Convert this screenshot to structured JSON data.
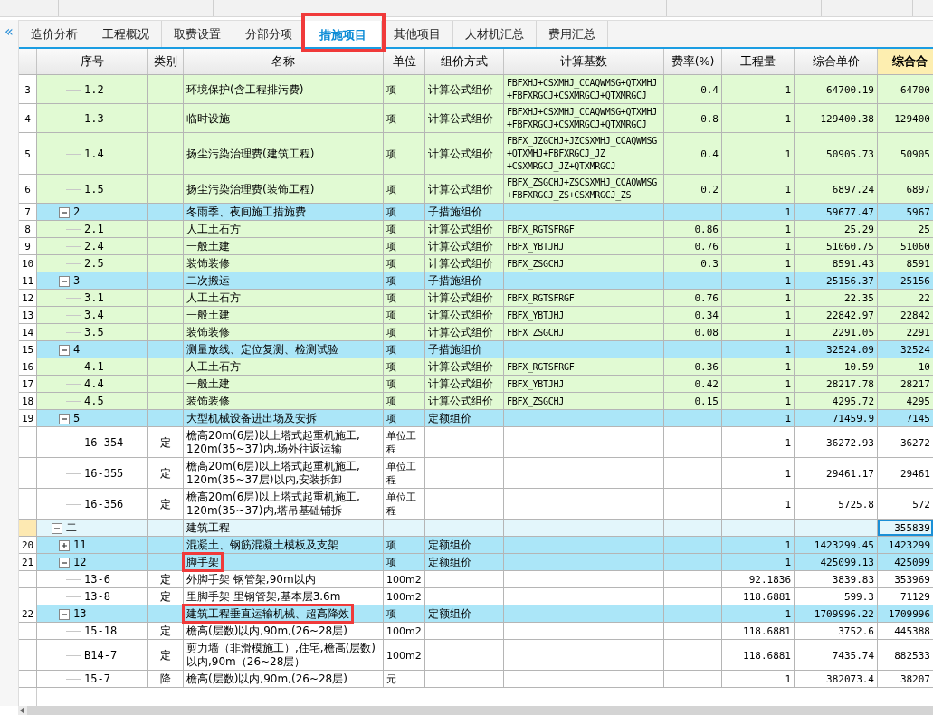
{
  "collapse_button": "«",
  "tabs": [
    {
      "label": "造价分析",
      "selected": false
    },
    {
      "label": "工程概况",
      "selected": false
    },
    {
      "label": "取费设置",
      "selected": false
    },
    {
      "label": "分部分项",
      "selected": false
    },
    {
      "label": "措施项目",
      "selected": true,
      "highlighted": true
    },
    {
      "label": "其他项目",
      "selected": false
    },
    {
      "label": "人材机汇总",
      "selected": false
    },
    {
      "label": "费用汇总",
      "selected": false
    }
  ],
  "table": {
    "columns": [
      "序号",
      "类别",
      "名称",
      "单位",
      "组价方式",
      "计算基数",
      "费率(%)",
      "工程量",
      "综合单价",
      "综合合"
    ],
    "rows": [
      {
        "children": [
          {
            "children": [
              {
                "kind": "measure",
                "selected": false,
                "index": "3",
                "code": "1.2",
                "name": "环境保护(含工程排污费)",
                "unit": "项",
                "method": "计算公式组价",
                "base": "FBFXHJ+CSXMHJ_CCAQWMSG+QTXMHJ\n+FBFXRGCJ+CSXMRGCJ+QTXMRGCJ",
                "rate": "0.4",
                "qty": "1",
                "unit_price": "64700.19",
                "total": "64700"
              },
              {
                "kind": "measure",
                "selected": false,
                "index": "4",
                "code": "1.3",
                "name": "临时设施",
                "unit": "项",
                "method": "计算公式组价",
                "base": "FBFXHJ+CSXMHJ_CCAQWMSG+QTXMHJ\n+FBFXRGCJ+CSXMRGCJ+QTXMRGCJ",
                "rate": "0.8",
                "qty": "1",
                "unit_price": "129400.38",
                "total": "129400"
              },
              {
                "kind": "measure",
                "selected": false,
                "index": "5",
                "code": "1.4",
                "name": "扬尘污染治理费(建筑工程)",
                "unit": "项",
                "method": "计算公式组价",
                "base": "FBFX_JZGCHJ+JZCSXMHJ_CCAQWMSG\n+QTXMHJ+FBFXRGCJ_JZ\n+CSXMRGCJ_JZ+QTXMRGCJ",
                "rate": "0.4",
                "qty": "1",
                "unit_price": "50905.73",
                "total": "50905"
              },
              {
                "kind": "measure",
                "selected": false,
                "index": "6",
                "code": "1.5",
                "name": "扬尘污染治理费(装饰工程)",
                "unit": "项",
                "method": "计算公式组价",
                "base": "FBFX_ZSGCHJ+ZSCSXMHJ_CCAQWMSG\n+FBFXRGCJ_ZS+CSXMRGCJ_ZS",
                "rate": "0.2",
                "qty": "1",
                "unit_price": "6897.24",
                "total": "6897"
              }
            ]
          },
          {
            "kind": "group",
            "selected": false,
            "expanded": true,
            "index": "7",
            "code": "2",
            "name": "冬雨季、夜间施工措施费",
            "unit": "项",
            "method": "子措施组价",
            "qty": "1",
            "unit_price": "59677.47",
            "total": "5967",
            "children": [
              {
                "kind": "measure",
                "selected": false,
                "index": "8",
                "code": "2.1",
                "name": "人工土石方",
                "unit": "项",
                "method": "计算公式组价",
                "base": "FBFX_RGTSFRGF",
                "rate": "0.86",
                "qty": "1",
                "unit_price": "25.29",
                "total": "25"
              },
              {
                "kind": "measure",
                "selected": false,
                "index": "9",
                "code": "2.4",
                "name": "一般土建",
                "unit": "项",
                "method": "计算公式组价",
                "base": "FBFX_YBTJHJ",
                "rate": "0.76",
                "qty": "1",
                "unit_price": "51060.75",
                "total": "51060"
              },
              {
                "kind": "measure",
                "selected": false,
                "index": "10",
                "code": "2.5",
                "name": "装饰装修",
                "unit": "项",
                "method": "计算公式组价",
                "base": "FBFX_ZSGCHJ",
                "rate": "0.3",
                "qty": "1",
                "unit_price": "8591.43",
                "total": "8591"
              }
            ]
          },
          {
            "kind": "group",
            "selected": false,
            "expanded": true,
            "index": "11",
            "code": "3",
            "name": "二次搬运",
            "unit": "项",
            "method": "子措施组价",
            "qty": "1",
            "unit_price": "25156.37",
            "total": "25156",
            "children": [
              {
                "kind": "measure",
                "selected": false,
                "index": "12",
                "code": "3.1",
                "name": "人工土石方",
                "unit": "项",
                "method": "计算公式组价",
                "base": "FBFX_RGTSFRGF",
                "rate": "0.76",
                "qty": "1",
                "unit_price": "22.35",
                "total": "22"
              },
              {
                "kind": "measure",
                "selected": false,
                "index": "13",
                "code": "3.4",
                "name": "一般土建",
                "unit": "项",
                "method": "计算公式组价",
                "base": "FBFX_YBTJHJ",
                "rate": "0.34",
                "qty": "1",
                "unit_price": "22842.97",
                "total": "22842"
              },
              {
                "kind": "measure",
                "selected": false,
                "index": "14",
                "code": "3.5",
                "name": "装饰装修",
                "unit": "项",
                "method": "计算公式组价",
                "base": "FBFX_ZSGCHJ",
                "rate": "0.08",
                "qty": "1",
                "unit_price": "2291.05",
                "total": "2291"
              }
            ]
          },
          {
            "kind": "group",
            "selected": false,
            "expanded": true,
            "index": "15",
            "code": "4",
            "name": "测量放线、定位复测、检测试验",
            "unit": "项",
            "method": "子措施组价",
            "qty": "1",
            "unit_price": "32524.09",
            "total": "32524",
            "children": [
              {
                "kind": "measure",
                "selected": false,
                "index": "16",
                "code": "4.1",
                "name": "人工土石方",
                "unit": "项",
                "method": "计算公式组价",
                "base": "FBFX_RGTSFRGF",
                "rate": "0.36",
                "qty": "1",
                "unit_price": "10.59",
                "total": "10"
              },
              {
                "kind": "measure",
                "selected": false,
                "index": "17",
                "code": "4.4",
                "name": "一般土建",
                "unit": "项",
                "method": "计算公式组价",
                "base": "FBFX_YBTJHJ",
                "rate": "0.42",
                "qty": "1",
                "unit_price": "28217.78",
                "total": "28217"
              },
              {
                "kind": "measure",
                "selected": false,
                "index": "18",
                "code": "4.5",
                "name": "装饰装修",
                "unit": "项",
                "method": "计算公式组价",
                "base": "FBFX_ZSGCHJ",
                "rate": "0.15",
                "qty": "1",
                "unit_price": "4295.72",
                "total": "4295"
              }
            ]
          },
          {
            "kind": "group",
            "selected": false,
            "expanded": true,
            "index": "19",
            "code": "5",
            "name": "大型机械设备进出场及安拆",
            "unit": "项",
            "method": "定额组价",
            "qty": "1",
            "unit_price": "71459.9",
            "total": "7145",
            "children": [
              {
                "kind": "quota",
                "selected": false,
                "code": "16-354",
                "type": "定",
                "name": "檐高20m(6层)以上塔式起重机施工,\n120m(35~37)内,场外往返运输",
                "unit": "单位工程",
                "qty": "1",
                "unit_price": "36272.93",
                "total": "36272"
              },
              {
                "kind": "quota",
                "selected": false,
                "code": "16-355",
                "type": "定",
                "name": "檐高20m(6层)以上塔式起重机施工,\n120m(35~37层)以内,安装拆卸",
                "unit": "单位工程",
                "qty": "1",
                "unit_price": "29461.17",
                "total": "29461"
              },
              {
                "kind": "quota",
                "selected": false,
                "code": "16-356",
                "type": "定",
                "name": "檐高20m(6层)以上塔式起重机施工,\n120m(35~37)内,塔吊基础铺拆",
                "unit": "单位工程",
                "qty": "1",
                "unit_price": "5725.8",
                "total": "572"
              }
            ]
          }
        ]
      },
      {
        "kind": "section",
        "selected": true,
        "expanded": true,
        "code": "二",
        "name": "建筑工程",
        "total": "355839",
        "children": [
          {
            "kind": "group",
            "selected": false,
            "expanded": false,
            "index": "20",
            "code": "11",
            "name": "混凝土、钢筋混凝土模板及支架",
            "unit": "项",
            "method": "定额组价",
            "qty": "1",
            "unit_price": "1423299.45",
            "total": "1423299"
          },
          {
            "kind": "group",
            "selected": false,
            "expanded": true,
            "index": "21",
            "code": "12",
            "highlighted": true,
            "name": "脚手架",
            "unit": "项",
            "method": "定额组价",
            "qty": "1",
            "unit_price": "425099.13",
            "total": "425099",
            "children": [
              {
                "kind": "quota",
                "selected": false,
                "code": "13-6",
                "type": "定",
                "name": "外脚手架 钢管架,90m以内",
                "unit": "100m2",
                "qty": "92.1836",
                "unit_price": "3839.83",
                "total": "353969"
              },
              {
                "kind": "quota",
                "selected": false,
                "code": "13-8",
                "type": "定",
                "name": "里脚手架 里钢管架,基本层3.6m",
                "unit": "100m2",
                "qty": "118.6881",
                "unit_price": "599.3",
                "total": "71129"
              }
            ]
          },
          {
            "kind": "group",
            "selected": false,
            "expanded": true,
            "index": "22",
            "code": "13",
            "highlighted": true,
            "name": "建筑工程垂直运输机械、超高降效",
            "unit": "项",
            "method": "定额组价",
            "qty": "1",
            "unit_price": "1709996.22",
            "total": "1709996",
            "children": [
              {
                "kind": "quota",
                "selected": false,
                "code": "15-18",
                "type": "定",
                "name": "檐高(层数)以内,90m,(26~28层)",
                "unit": "100m2",
                "qty": "118.6881",
                "unit_price": "3752.6",
                "total": "445388"
              },
              {
                "kind": "quota",
                "selected": false,
                "code": "B14-7",
                "type": "定",
                "name": "剪力墙（非滑模施工）,住宅,檐高(层数)以内,90m（26~28层）",
                "unit": "100m2",
                "qty": "118.6881",
                "unit_price": "7435.74",
                "total": "882533"
              },
              {
                "kind": "quota",
                "selected": false,
                "code": "15-7",
                "type": "降",
                "name": "檐高(层数)以内,90m,(26~28层)",
                "unit": "元",
                "qty": "1",
                "unit_price": "382073.4",
                "total": "38207"
              }
            ]
          }
        ]
      }
    ]
  }
}
